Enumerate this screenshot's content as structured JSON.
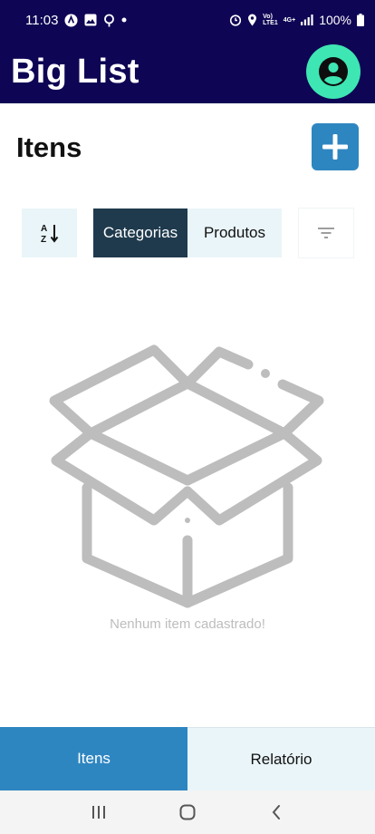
{
  "status_bar": {
    "time": "11:03",
    "network_label_top": "Vo)",
    "network_label_bottom": "LTE1",
    "network_type": "4G+",
    "battery": "100%"
  },
  "header": {
    "title": "Big List",
    "avatar_icon": "account-circle-icon"
  },
  "section": {
    "title": "Itens",
    "add_icon": "plus-icon"
  },
  "toolbar": {
    "sort_icon": "sort-alpha-icon",
    "segments": [
      {
        "label": "Categorias",
        "active": true
      },
      {
        "label": "Produtos",
        "active": false
      }
    ],
    "filter_icon": "filter-icon"
  },
  "empty_state": {
    "illustration": "open-box-icon",
    "message": "Nenhum item cadastrado!"
  },
  "tabs": [
    {
      "label": "Itens",
      "active": true
    },
    {
      "label": "Relatório",
      "active": false
    }
  ],
  "colors": {
    "header_bg": "#0e0554",
    "avatar_bg": "#3ee6b3",
    "accent": "#2e86c1",
    "segment_active": "#1f3a4d",
    "light_bg": "#eaf5f9",
    "placeholder": "#bdbdbd"
  }
}
